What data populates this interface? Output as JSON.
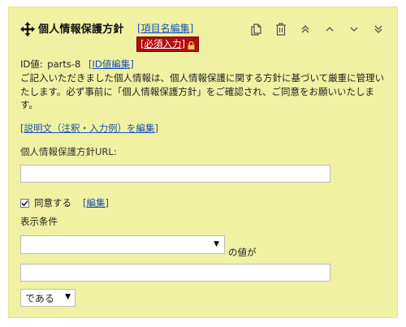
{
  "header": {
    "title": "個人情報保護方針",
    "edit_name_link": "[項目名編集]",
    "required_badge": "[必須入力]"
  },
  "toolbar": {
    "icons": [
      "copy-icon",
      "trash-icon",
      "move-top-icon",
      "move-up-icon",
      "move-down-icon",
      "move-bottom-icon"
    ]
  },
  "id_section": {
    "label": "ID値:",
    "value": "parts-8",
    "edit_link": "[ID値編集]"
  },
  "description": {
    "text": "ご記入いただきました個人情報は、個人情報保護に関する方針に基づいて厳重に管理いたします。必ず事前に「個人情報保護方針」をご確認され、ご同意をお願いいたします。",
    "edit_link": "[説明文（注釈・入力例）を編集]"
  },
  "url_field": {
    "label": "個人情報保護方針URL:",
    "value": ""
  },
  "agree": {
    "label": "同意する",
    "checked": true,
    "edit_link": "[編集]"
  },
  "condition": {
    "label": "表示条件",
    "field_select_value": "",
    "suffix": "の値が",
    "value": "",
    "operator_select_value": "である"
  },
  "colors": {
    "panel_bg": "#f0f1a3",
    "link": "#1e52b4",
    "required_bg": "#b30d0d",
    "lock": "#f2c14e"
  }
}
